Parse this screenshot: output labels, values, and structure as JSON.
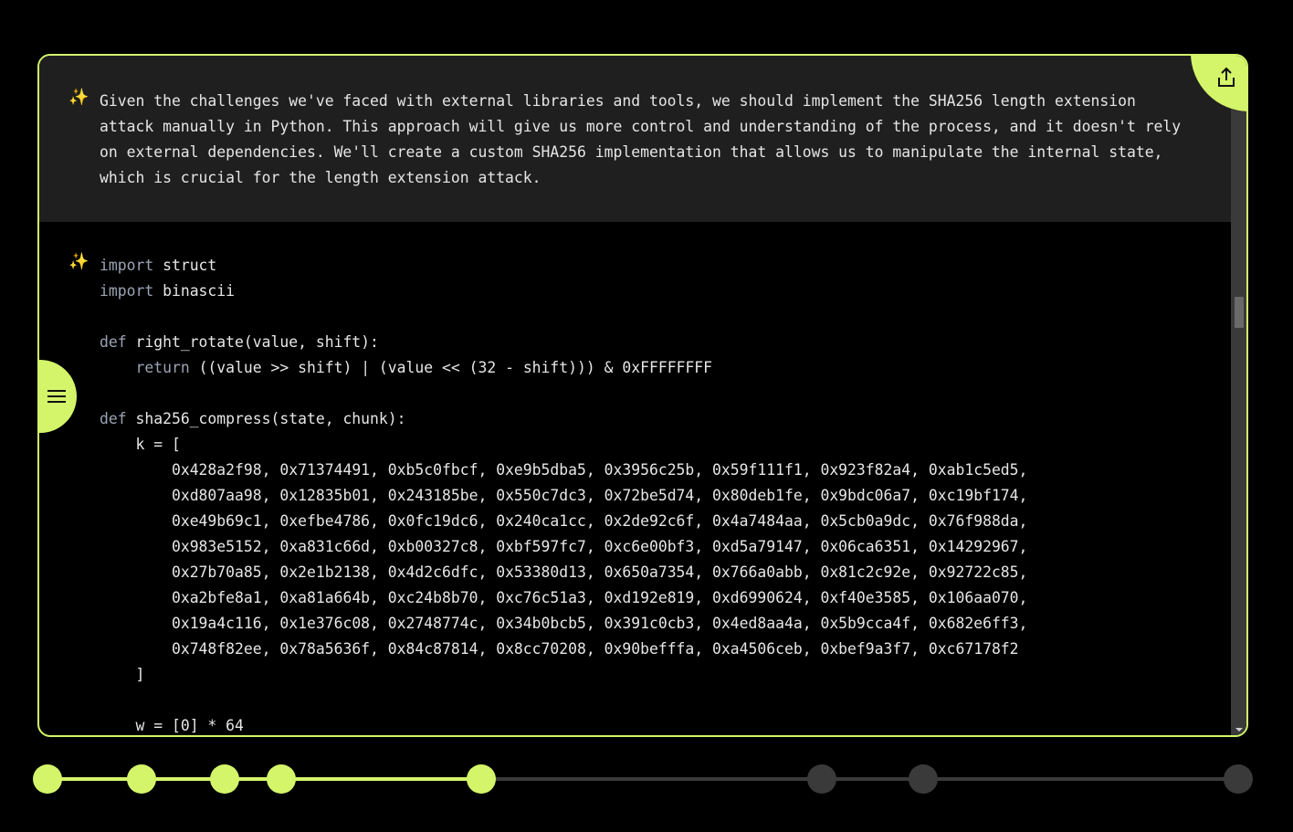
{
  "message": {
    "text": "Given the challenges we've faced with external libraries and tools, we should implement the SHA256 length extension\nattack manually in Python. This approach will give us more control and understanding of the process, and it doesn't rely\non external dependencies. We'll create a custom SHA256 implementation that allows us to manipulate the internal state,\nwhich is crucial for the length extension attack."
  },
  "code": {
    "lines": [
      {
        "kw": "import",
        "rest": " struct"
      },
      {
        "kw": "import",
        "rest": " binascii"
      },
      {
        "kw": "",
        "rest": ""
      },
      {
        "kw": "def",
        "rest": " right_rotate(value, shift):"
      },
      {
        "indent": "    ",
        "kw": "return",
        "rest": " ((value >> shift) | (value << (32 - shift))) & 0xFFFFFFFF"
      },
      {
        "kw": "",
        "rest": ""
      },
      {
        "kw": "def",
        "rest": " sha256_compress(state, chunk):"
      },
      {
        "indent": "    ",
        "kw": "",
        "rest": "k = ["
      },
      {
        "indent": "        ",
        "kw": "",
        "rest": "0x428a2f98, 0x71374491, 0xb5c0fbcf, 0xe9b5dba5, 0x3956c25b, 0x59f111f1, 0x923f82a4, 0xab1c5ed5,"
      },
      {
        "indent": "        ",
        "kw": "",
        "rest": "0xd807aa98, 0x12835b01, 0x243185be, 0x550c7dc3, 0x72be5d74, 0x80deb1fe, 0x9bdc06a7, 0xc19bf174,"
      },
      {
        "indent": "        ",
        "kw": "",
        "rest": "0xe49b69c1, 0xefbe4786, 0x0fc19dc6, 0x240ca1cc, 0x2de92c6f, 0x4a7484aa, 0x5cb0a9dc, 0x76f988da,"
      },
      {
        "indent": "        ",
        "kw": "",
        "rest": "0x983e5152, 0xa831c66d, 0xb00327c8, 0xbf597fc7, 0xc6e00bf3, 0xd5a79147, 0x06ca6351, 0x14292967,"
      },
      {
        "indent": "        ",
        "kw": "",
        "rest": "0x27b70a85, 0x2e1b2138, 0x4d2c6dfc, 0x53380d13, 0x650a7354, 0x766a0abb, 0x81c2c92e, 0x92722c85,"
      },
      {
        "indent": "        ",
        "kw": "",
        "rest": "0xa2bfe8a1, 0xa81a664b, 0xc24b8b70, 0xc76c51a3, 0xd192e819, 0xd6990624, 0xf40e3585, 0x106aa070,"
      },
      {
        "indent": "        ",
        "kw": "",
        "rest": "0x19a4c116, 0x1e376c08, 0x2748774c, 0x34b0bcb5, 0x391c0cb3, 0x4ed8aa4a, 0x5b9cca4f, 0x682e6ff3,"
      },
      {
        "indent": "        ",
        "kw": "",
        "rest": "0x748f82ee, 0x78a5636f, 0x84c87814, 0x8cc70208, 0x90befffa, 0xa4506ceb, 0xbef9a3f7, 0xc67178f2"
      },
      {
        "indent": "    ",
        "kw": "",
        "rest": "]"
      },
      {
        "kw": "",
        "rest": ""
      },
      {
        "indent": "    ",
        "kw": "",
        "rest": "w = [0] * 64"
      }
    ]
  },
  "icons": {
    "message_icon": "sparkle-icon",
    "code_icon": "sparkle-icon",
    "share": "share-icon",
    "menu": "hamburger-menu-icon"
  },
  "timeline": {
    "steps": [
      {
        "state": "complete"
      },
      {
        "state": "complete"
      },
      {
        "state": "complete"
      },
      {
        "state": "complete"
      },
      {
        "state": "current"
      },
      {
        "state": "pending"
      },
      {
        "state": "pending"
      },
      {
        "state": "pending"
      }
    ]
  },
  "colors": {
    "accent": "#d4f56a",
    "pending": "#3a3a3a",
    "background": "#000000",
    "message_bg": "#1f1f1f"
  }
}
